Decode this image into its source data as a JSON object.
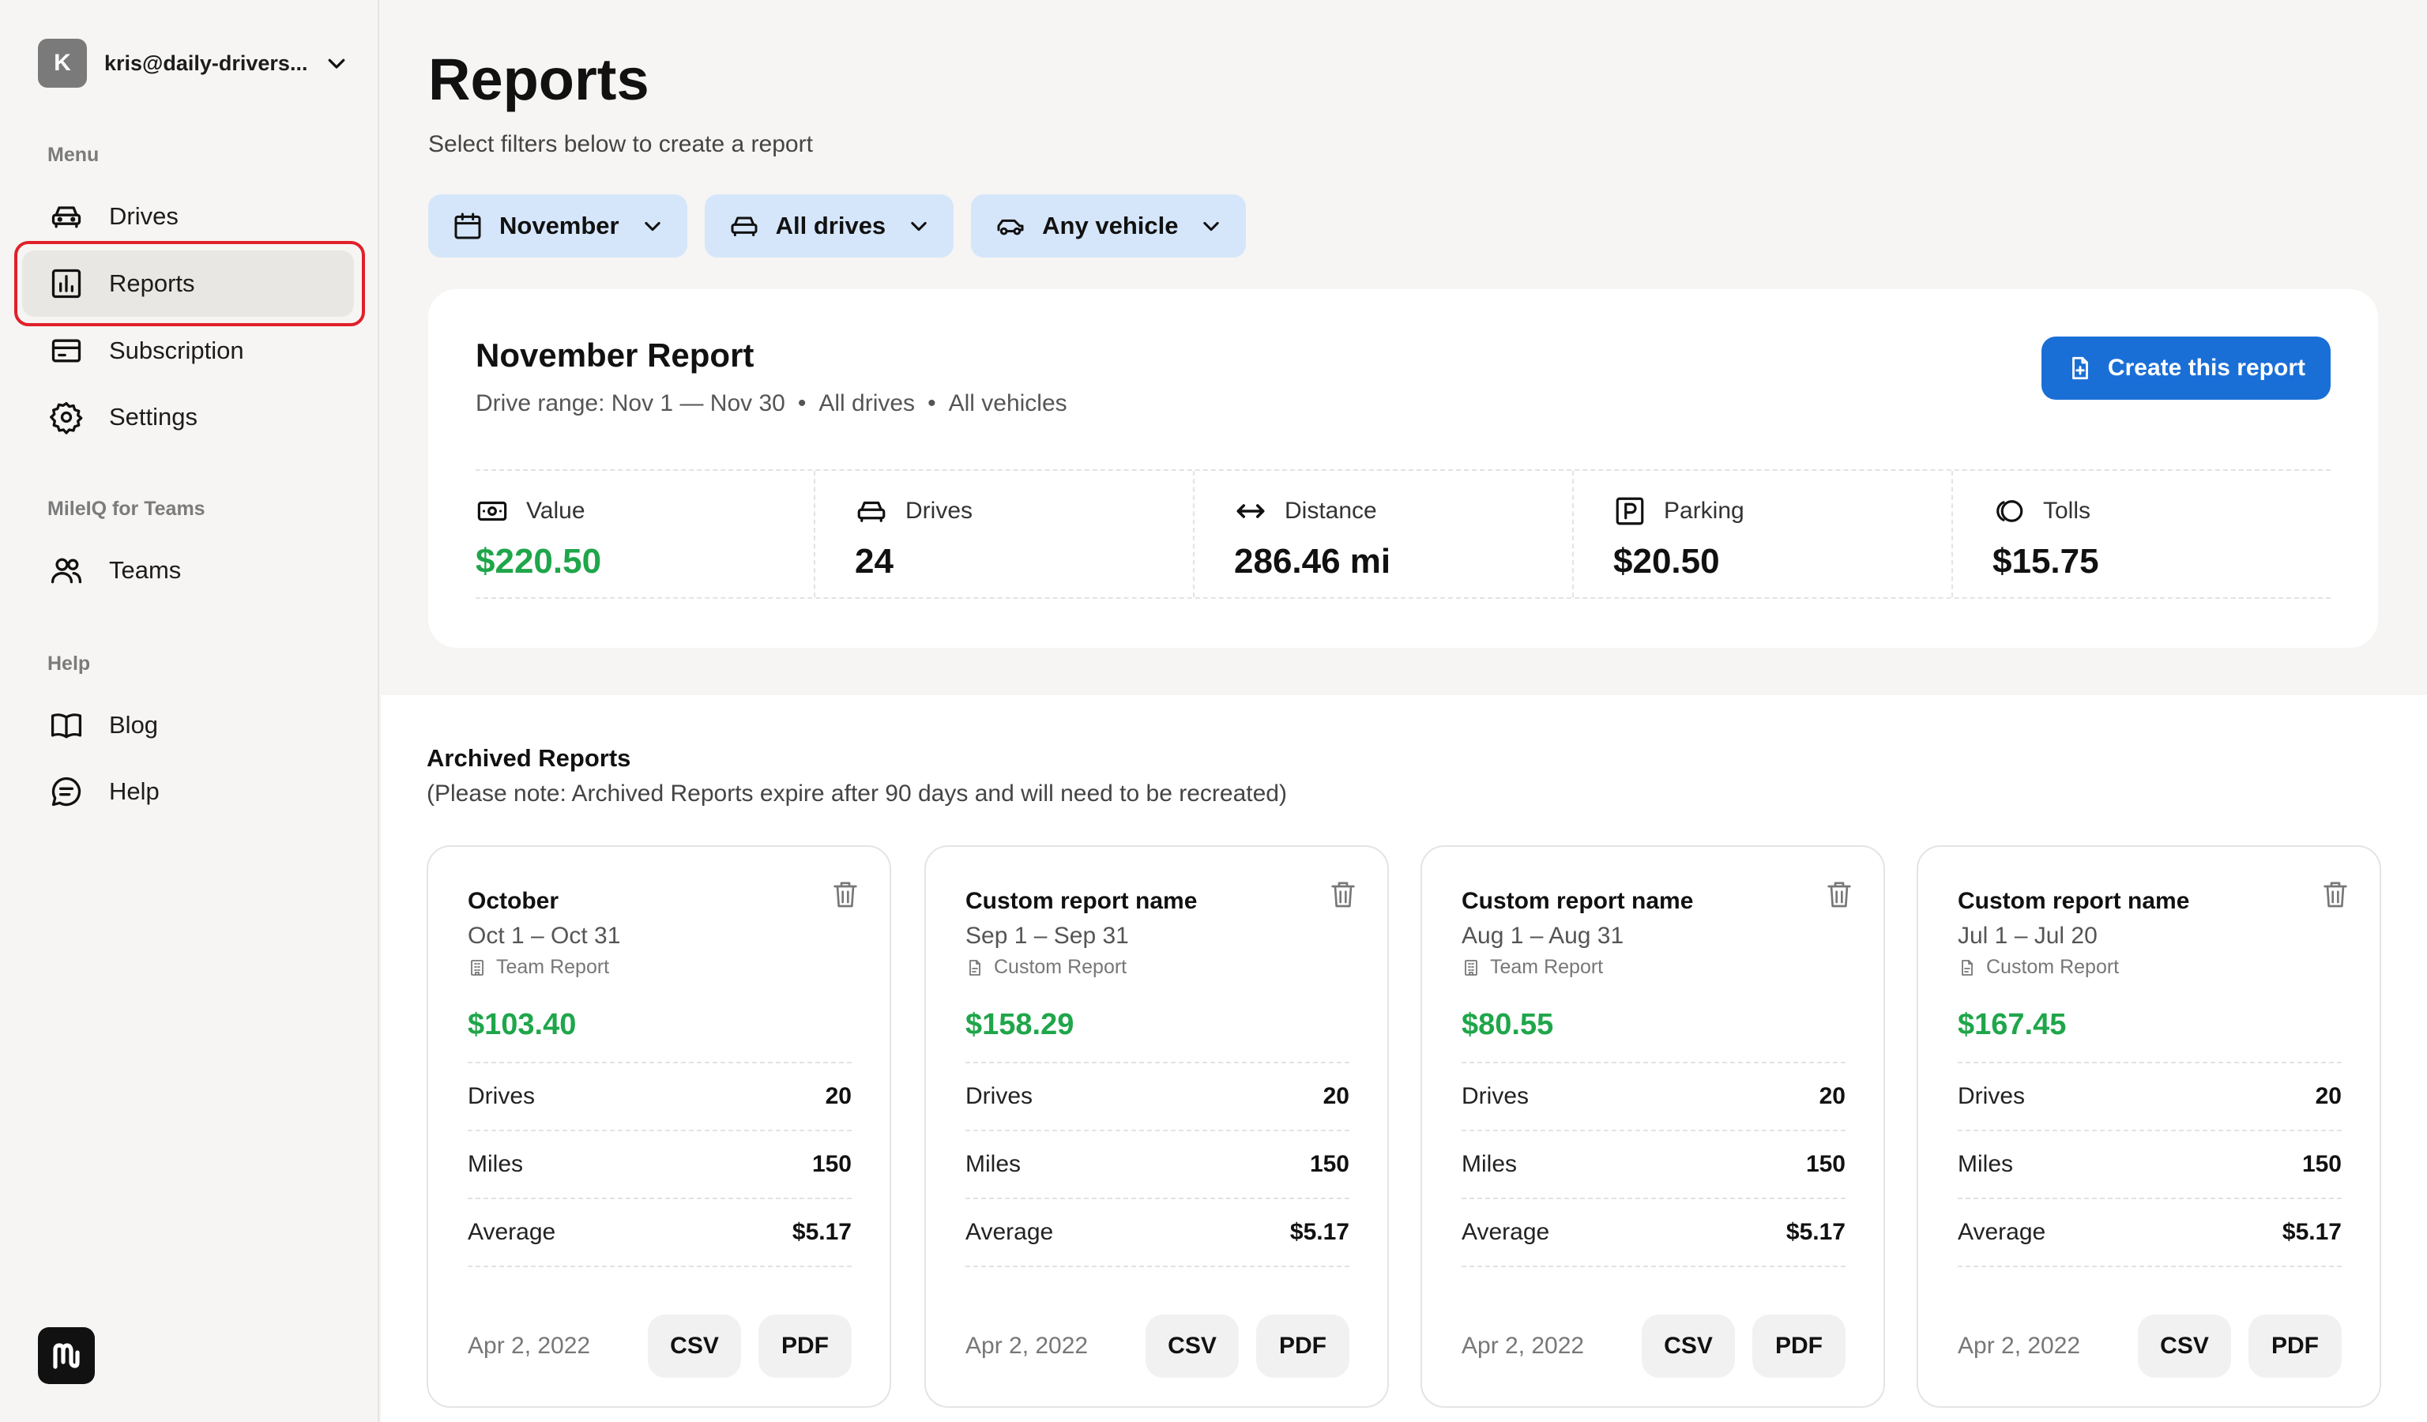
{
  "account": {
    "initial": "K",
    "email": "kris@daily-drivers..."
  },
  "sidebar": {
    "menu_label": "Menu",
    "menu_items": [
      {
        "label": "Drives",
        "icon": "car-icon"
      },
      {
        "label": "Reports",
        "icon": "bar-chart-icon",
        "active": true
      },
      {
        "label": "Subscription",
        "icon": "credit-card-icon"
      },
      {
        "label": "Settings",
        "icon": "gear-icon"
      }
    ],
    "teams_label": "MileIQ for Teams",
    "teams_items": [
      {
        "label": "Teams",
        "icon": "users-icon"
      }
    ],
    "help_label": "Help",
    "help_items": [
      {
        "label": "Blog",
        "icon": "book-icon"
      },
      {
        "label": "Help",
        "icon": "chat-icon"
      }
    ]
  },
  "header": {
    "title": "Reports",
    "subtitle": "Select filters below to create a report"
  },
  "filters": [
    {
      "label": "November",
      "icon": "calendar-icon"
    },
    {
      "label": "All drives",
      "icon": "car-icon"
    },
    {
      "label": "Any vehicle",
      "icon": "car-side-icon"
    }
  ],
  "current_report": {
    "title": "November Report",
    "range": "Drive range: Nov 1 — Nov 30",
    "drives_filter": "All drives",
    "vehicles_filter": "All vehicles",
    "separator": "•",
    "create_label": "Create this report",
    "stats": [
      {
        "label": "Value",
        "value": "$220.50",
        "icon": "money-icon"
      },
      {
        "label": "Drives",
        "value": "24",
        "icon": "car-icon"
      },
      {
        "label": "Distance",
        "value": "286.46 mi",
        "icon": "arrows-horizontal-icon"
      },
      {
        "label": "Parking",
        "value": "$20.50",
        "icon": "parking-icon"
      },
      {
        "label": "Tolls",
        "value": "$15.75",
        "icon": "toll-icon"
      }
    ]
  },
  "archived": {
    "title": "Archived Reports",
    "note": "(Please note: Archived Reports expire after 90 days and will need to be recreated)",
    "row_labels": {
      "drives": "Drives",
      "miles": "Miles",
      "average": "Average"
    },
    "csv_label": "CSV",
    "pdf_label": "PDF",
    "cards": [
      {
        "name": "October",
        "range": "Oct 1 – Oct 31",
        "type": "Team Report",
        "amount": "$103.40",
        "drives": "20",
        "miles": "150",
        "average": "$5.17",
        "date": "Apr 2, 2022"
      },
      {
        "name": "Custom report name",
        "range": "Sep 1 – Sep 31",
        "type": "Custom Report",
        "amount": "$158.29",
        "drives": "20",
        "miles": "150",
        "average": "$5.17",
        "date": "Apr 2, 2022"
      },
      {
        "name": "Custom report name",
        "range": "Aug 1 – Aug 31",
        "type": "Team Report",
        "amount": "$80.55",
        "drives": "20",
        "miles": "150",
        "average": "$5.17",
        "date": "Apr 2, 2022"
      },
      {
        "name": "Custom report name",
        "range": "Jul 1 – Jul 20",
        "type": "Custom Report",
        "amount": "$167.45",
        "drives": "20",
        "miles": "150",
        "average": "$5.17",
        "date": "Apr 2, 2022"
      }
    ]
  },
  "colors": {
    "accent": "#1a6fd6",
    "money": "#1fa64a",
    "filter_bg": "#d6e6fa",
    "active_outline": "#e0202a"
  }
}
